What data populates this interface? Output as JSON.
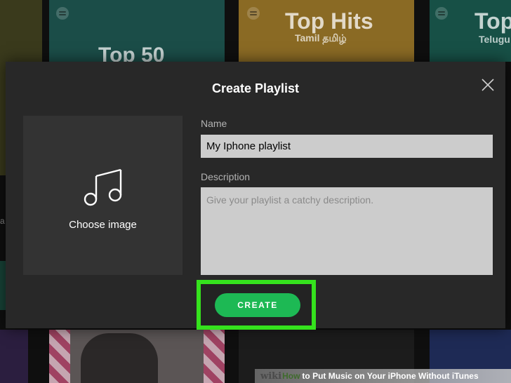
{
  "background": {
    "tiles": {
      "top50": {
        "title": "Top 50"
      },
      "tophits": {
        "title": "Top Hits",
        "subtitle": "Tamil தமிழ்"
      },
      "right": {
        "title": "Top",
        "subtitle": "Telugu"
      }
    },
    "edge_letter": "a"
  },
  "modal": {
    "title": "Create Playlist",
    "close_icon": "close-icon",
    "image_picker": {
      "icon": "music-note-icon",
      "label": "Choose image"
    },
    "name": {
      "label": "Name",
      "value": "My Iphone playlist"
    },
    "description": {
      "label": "Description",
      "placeholder": "Give your playlist a catchy description.",
      "value": ""
    },
    "create_button": "CREATE"
  },
  "colors": {
    "accent": "#1db954",
    "highlight": "#35e21d",
    "modal_bg": "#282828",
    "input_bg": "#cccccc"
  },
  "watermark": {
    "brand": "wiki",
    "how": "How",
    "text": "to Put Music on Your iPhone Without iTunes"
  }
}
